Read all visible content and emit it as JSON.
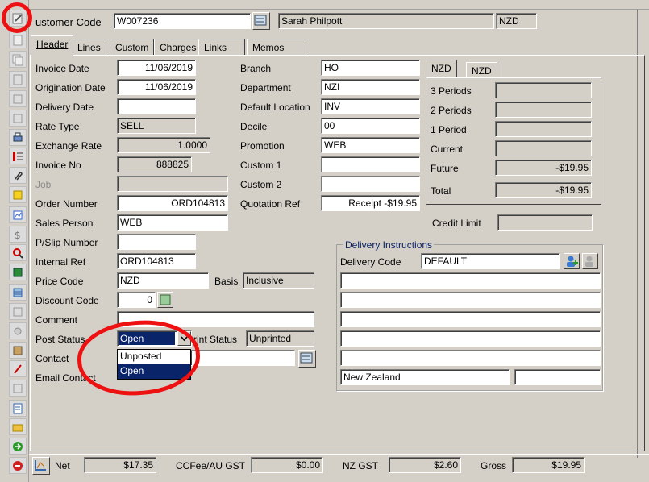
{
  "header": {
    "customer_code_label": "ustomer Code",
    "customer_code": "W007236",
    "customer_name": "Sarah Philpott",
    "currency": "NZD"
  },
  "tabs": [
    "Header",
    "Lines",
    "Custom",
    "Charges",
    "Links",
    "Memos"
  ],
  "left_form": {
    "invoice_date_label": "Invoice Date",
    "invoice_date": "11/06/2019",
    "origination_date_label": "Origination Date",
    "origination_date": "11/06/2019",
    "delivery_date_label": "Delivery Date",
    "delivery_date": "",
    "rate_type_label": "Rate Type",
    "rate_type": "SELL",
    "exchange_rate_label": "Exchange Rate",
    "exchange_rate": "1.0000",
    "invoice_no_label": "Invoice No",
    "invoice_no": "888825",
    "job_label": "Job",
    "job": "",
    "order_number_label": "Order Number",
    "order_number": "ORD104813",
    "sales_person_label": "Sales Person",
    "sales_person": "WEB",
    "pslip_label": "P/Slip Number",
    "pslip": "",
    "internal_ref_label": "Internal Ref",
    "internal_ref": "ORD104813",
    "price_code_label": "Price Code",
    "price_code": "NZD",
    "basis_label": "Basis",
    "basis": "Inclusive",
    "discount_code_label": "Discount Code",
    "discount_code": "0",
    "comment_label": "Comment",
    "comment": "",
    "post_status_label": "Post Status",
    "post_status": "Open",
    "print_status_label": "rint Status",
    "print_status": "Unprinted",
    "contact_label": "Contact",
    "contact": "",
    "email_contact_label": "Email Contact",
    "post_status_options": [
      "Unposted",
      "Open"
    ]
  },
  "middle_form": {
    "branch_label": "Branch",
    "branch": "HO",
    "department_label": "Department",
    "department": "NZI",
    "default_location_label": "Default Location",
    "default_location": "INV",
    "decile_label": "Decile",
    "decile": "00",
    "promotion_label": "Promotion",
    "promotion": "WEB",
    "custom1_label": "Custom 1",
    "custom1": "",
    "custom2_label": "Custom 2",
    "custom2": "",
    "quotation_ref_label": "Quotation Ref",
    "quotation_ref": "Receipt -$19.95"
  },
  "aging": {
    "tabs": [
      "NZD",
      "NZD"
    ],
    "rows": [
      {
        "label": "3 Periods",
        "value": ""
      },
      {
        "label": "2 Periods",
        "value": ""
      },
      {
        "label": "1 Period",
        "value": ""
      },
      {
        "label": "Current",
        "value": ""
      },
      {
        "label": "Future",
        "value": "-$19.95"
      },
      {
        "label": "Total",
        "value": "-$19.95"
      }
    ],
    "credit_limit_label": "Credit Limit",
    "credit_limit": ""
  },
  "delivery": {
    "title": "Delivery Instructions",
    "delivery_code_label": "Delivery Code",
    "delivery_code": "DEFAULT",
    "country": "New Zealand"
  },
  "footer": {
    "net_label": "Net",
    "net": "$17.35",
    "ccfee_label": "CCFee/AU GST",
    "ccfee": "$0.00",
    "nzgst_label": "NZ GST",
    "nzgst": "$2.60",
    "gross_label": "Gross",
    "gross": "$19.95"
  },
  "colors": {
    "selection": "#0a246a",
    "annotation": "#ee1111",
    "window": "#d4d0c8"
  }
}
